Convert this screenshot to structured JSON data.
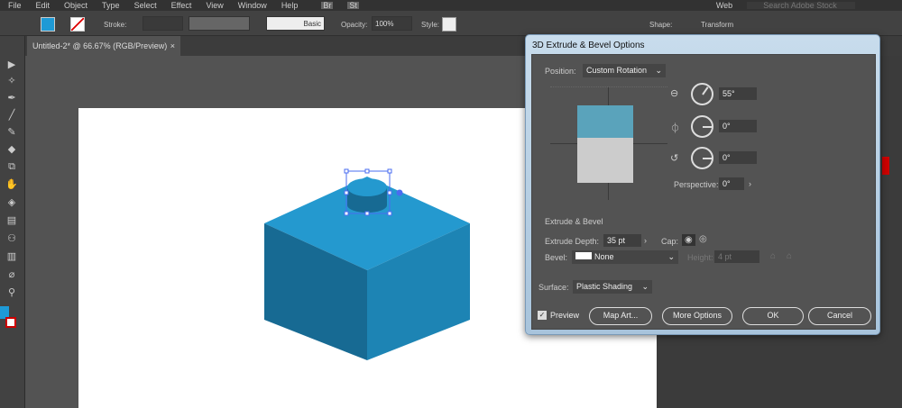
{
  "menu": [
    "File",
    "Edit",
    "Object",
    "Type",
    "Select",
    "Effect",
    "View",
    "Window",
    "Help"
  ],
  "menu_right": {
    "br": "Br",
    "st": "St",
    "workspace": "Web",
    "search_placeholder": "Search Adobe Stock"
  },
  "control": {
    "stroke_label": "Stroke:",
    "brush_label": "Basic",
    "opacity_label": "Opacity:",
    "opacity_value": "100%",
    "style_label": "Style:",
    "shape_label": "Shape:",
    "transform_label": "Transform",
    "fill_color": "#1e9ad6"
  },
  "document": {
    "tab_title": "Untitled-2* @ 66.67% (RGB/Preview)",
    "close": "×"
  },
  "dialog": {
    "title": "3D Extrude & Bevel Options",
    "position_label": "Position:",
    "position_value": "Custom Rotation",
    "x_rotation": "55°",
    "y_rotation": "0°",
    "z_rotation": "0°",
    "perspective_label": "Perspective:",
    "perspective_value": "0°",
    "section_extrude": "Extrude & Bevel",
    "depth_label": "Extrude Depth:",
    "depth_value": "35 pt",
    "cap_label": "Cap:",
    "bevel_label": "Bevel:",
    "bevel_value": "None",
    "height_label": "Height:",
    "height_value": "4 pt",
    "surface_label": "Surface:",
    "surface_value": "Plastic Shading",
    "preview_label": "Preview",
    "preview_checked": true,
    "map_art": "Map Art...",
    "more_options": "More Options",
    "ok": "OK",
    "cancel": "Cancel"
  },
  "colors": {
    "cube_top": "#2499cf",
    "cube_left": "#176a93",
    "cube_right": "#1d84b4",
    "preview_top": "#5aa3bb",
    "preview_bottom": "#cccccc"
  }
}
